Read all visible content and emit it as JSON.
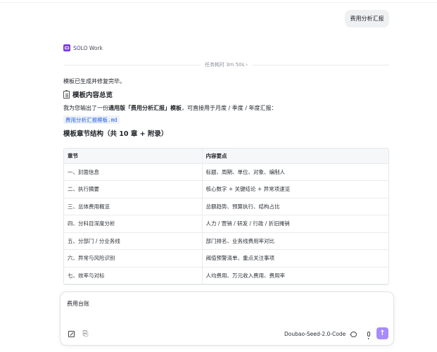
{
  "user_message": "费用分析汇报",
  "agent": {
    "name": "SOLO Work",
    "logo_icon": "solo-logo-icon",
    "logo_color": "#7c3aed"
  },
  "duration": {
    "text": "任务耗时 3m 50s",
    "chevron": "›"
  },
  "reply": {
    "done_line": "模板已生成并修复完毕。",
    "overview_heading": "模板内容总览",
    "intro_prefix": "我为您输出了一份",
    "intro_bold": "通用版「费用分析汇报」模板",
    "intro_suffix": "，可直接用于月度 / 季度 / 年度汇报：",
    "file_link": "费用分析汇报模板.md",
    "structure_heading": "模板章节结构（共 10 章 + 附录）"
  },
  "table": {
    "headers": [
      "章节",
      "内容要点"
    ],
    "rows": [
      [
        "一、封面信息",
        "标题、周期、单位、对象、编制人"
      ],
      [
        "二、执行摘要",
        "核心数字 + 关键结论 + 异常项速览"
      ],
      [
        "三、总体费用概览",
        "总额趋势、预算执行、结构占比"
      ],
      [
        "四、分科目深度分析",
        "人力 / 营销 / 研发 / 行政 / 折旧摊销"
      ],
      [
        "五、分部门 / 分业务线",
        "部门排名、业务线费用率对比"
      ],
      [
        "六、异常与风险识别",
        "阈值预警清单、重点关注事项"
      ],
      [
        "七、效率与对标",
        "人均费用、万元收入费用、费用率"
      ]
    ]
  },
  "composer": {
    "text": "费用台账",
    "model": "Doubao-Seed-2.0-Code",
    "model_chevron": "⌄",
    "attach_glyph": "⎘",
    "send_glyph": "↑",
    "send_color": "#a78bfa"
  }
}
